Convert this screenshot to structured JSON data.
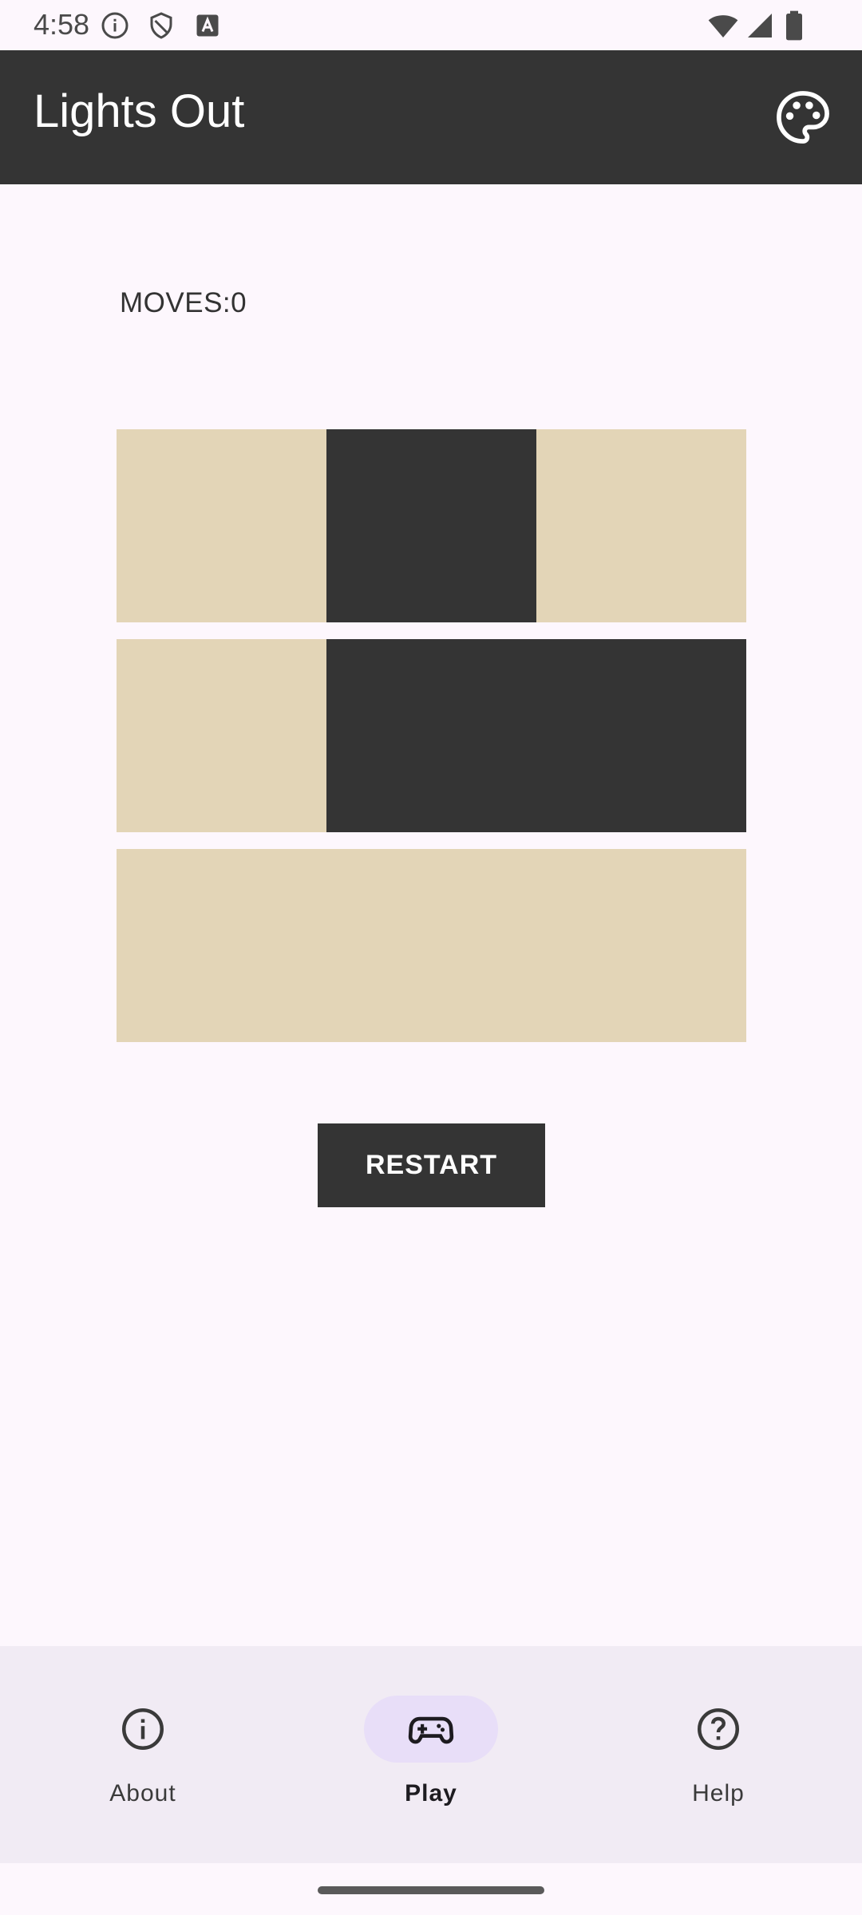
{
  "status_bar": {
    "time": "4:58"
  },
  "app_bar": {
    "title": "Lights Out",
    "action_icon": "palette-icon"
  },
  "game": {
    "moves_label": "MOVES:0",
    "colors": {
      "on": "#343434",
      "off": "#e3d5b7"
    },
    "board": [
      [
        "off",
        "on",
        "off"
      ],
      [
        "off",
        "on",
        "on"
      ],
      [
        "off",
        "off",
        "off"
      ]
    ],
    "restart_label": "RESTART"
  },
  "bottom_nav": {
    "items": [
      {
        "label": "About",
        "icon": "info-icon",
        "active": false
      },
      {
        "label": "Play",
        "icon": "gamepad-icon",
        "active": true
      },
      {
        "label": "Help",
        "icon": "help-icon",
        "active": false
      }
    ]
  }
}
